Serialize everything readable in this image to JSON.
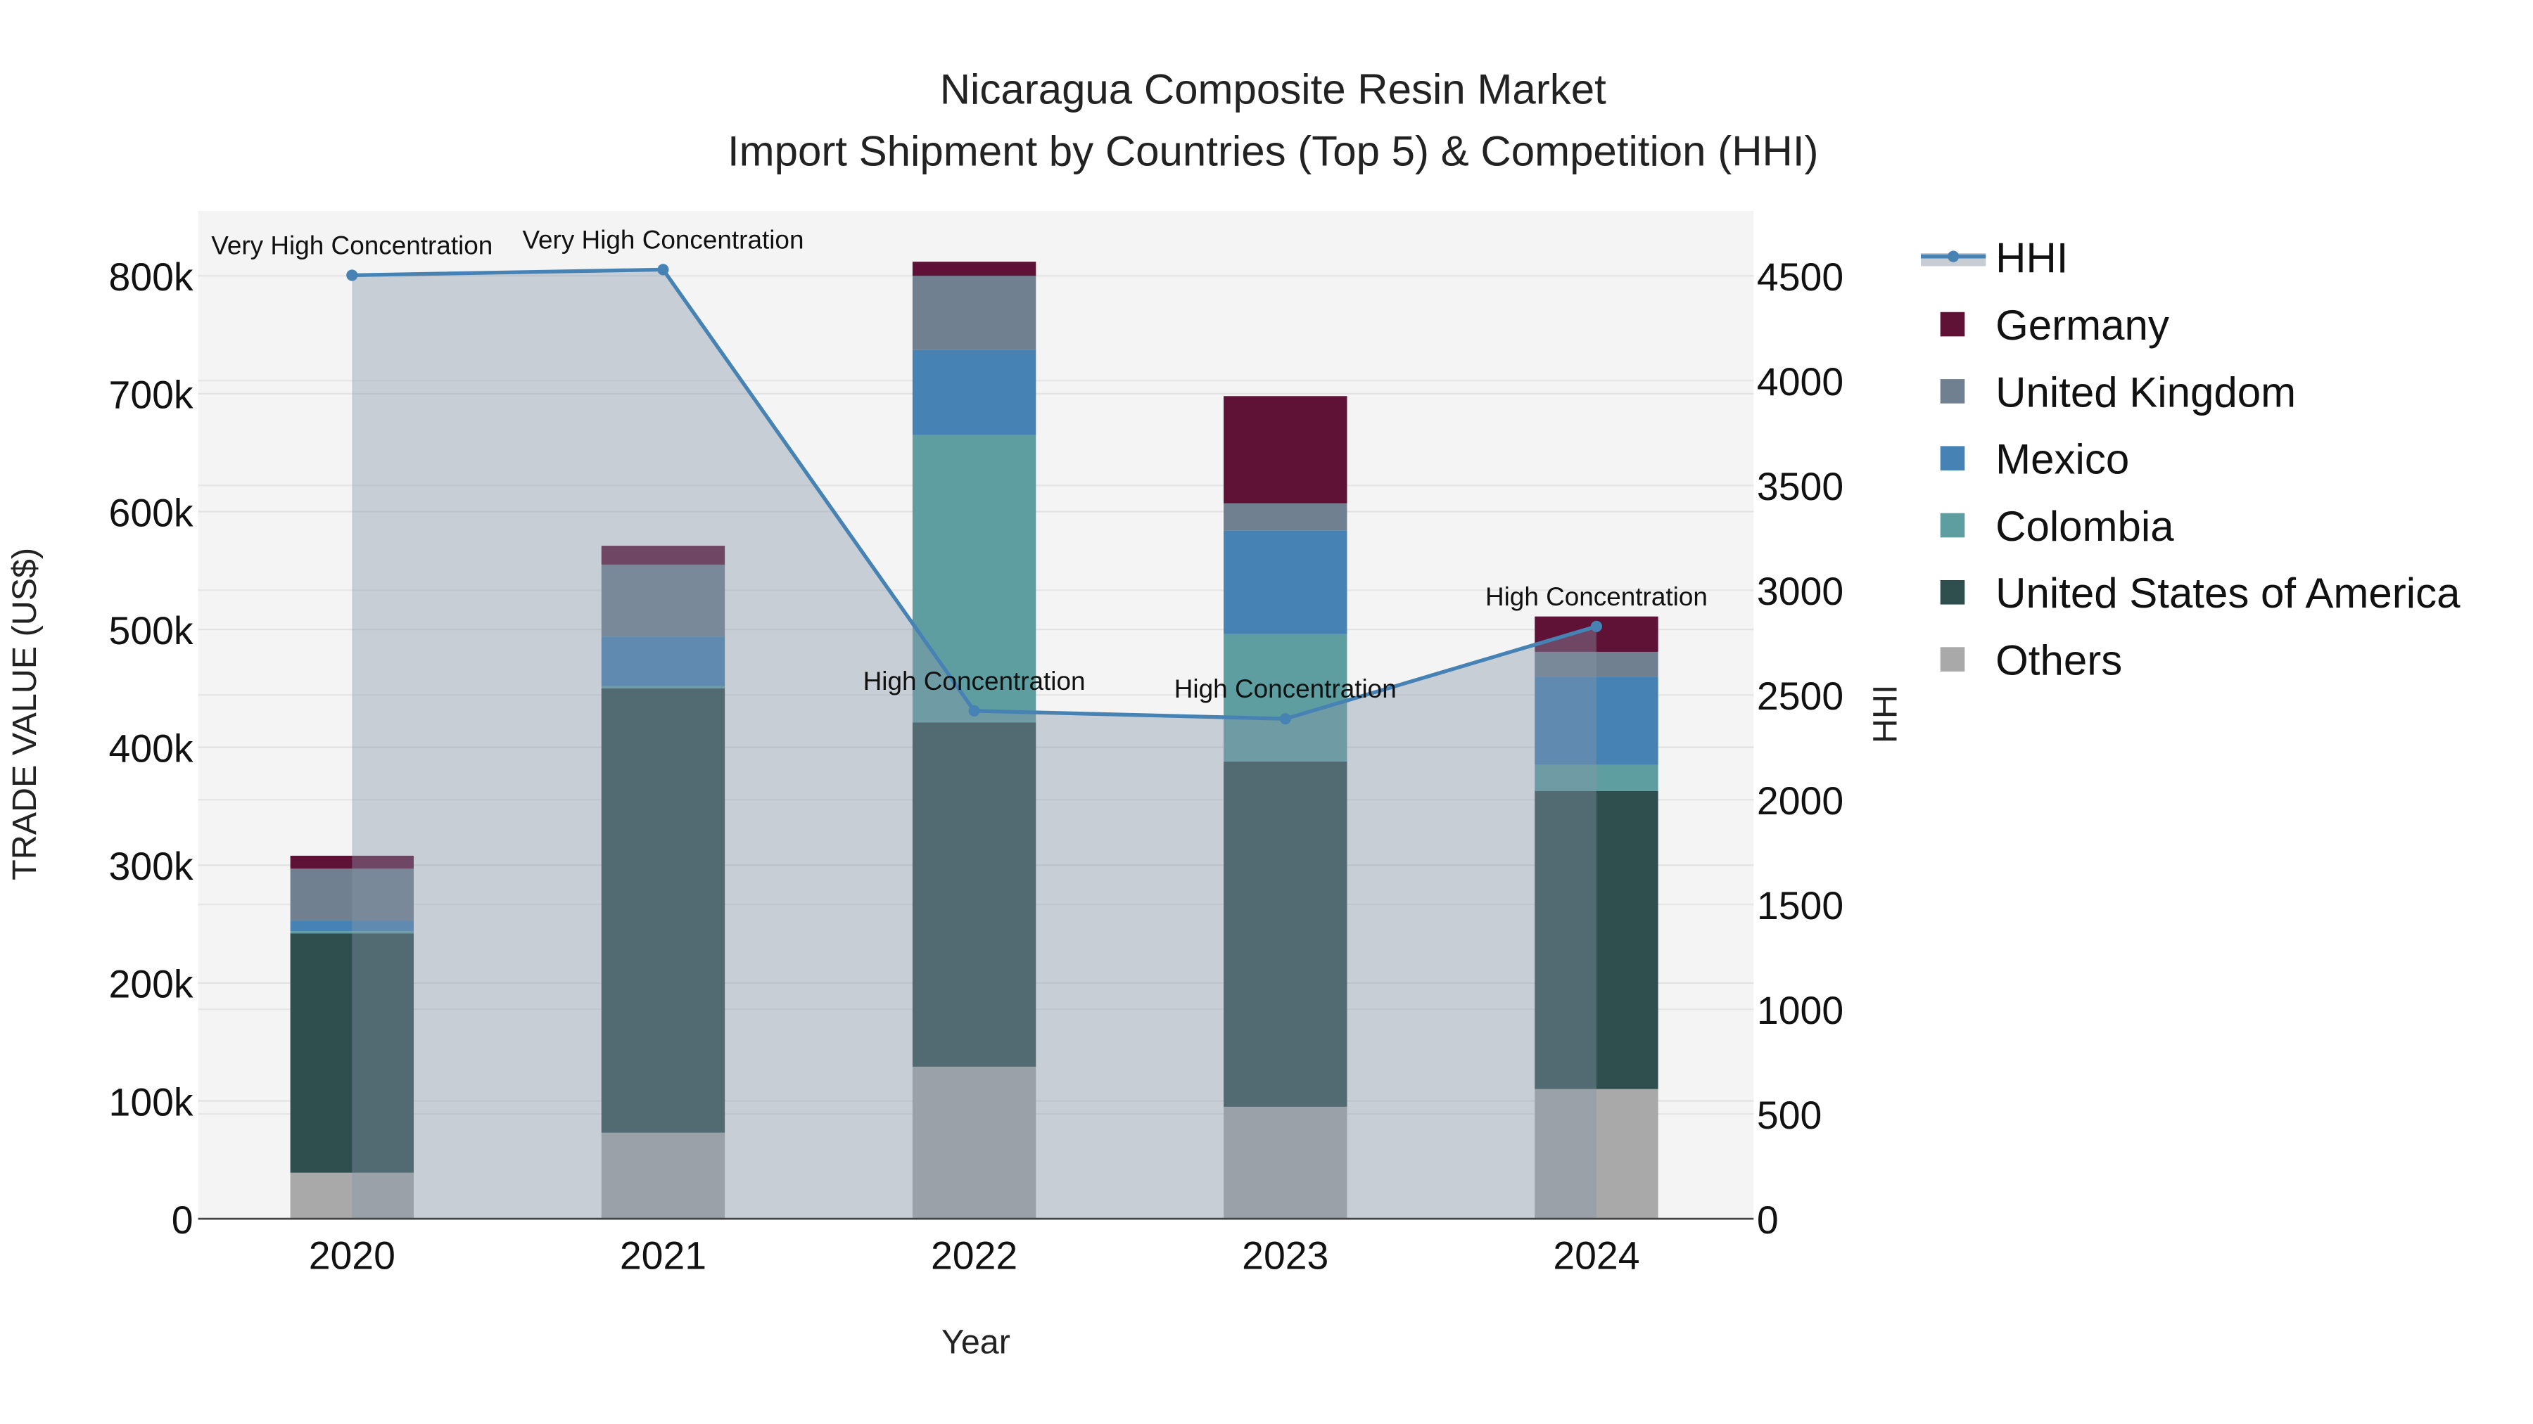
{
  "chart_data": {
    "type": "bar",
    "stacked": true,
    "title": "Nicaragua Composite Resin Market",
    "subtitle": "Import Shipment by Countries (Top 5) & Competition (HHI)",
    "xlabel": "Year",
    "ylabel": "TRADE VALUE (US$)",
    "y2label": "HHI",
    "categories": [
      "2020",
      "2021",
      "2022",
      "2023",
      "2024"
    ],
    "ylim": [
      0,
      860000
    ],
    "y2lim": [
      0,
      4820
    ],
    "yticks": [
      0,
      100000,
      200000,
      300000,
      400000,
      500000,
      600000,
      700000,
      800000
    ],
    "ytick_labels": [
      "0",
      "100k",
      "200k",
      "300k",
      "400k",
      "500k",
      "600k",
      "700k",
      "800k"
    ],
    "y2ticks": [
      0,
      500,
      1000,
      1500,
      2000,
      2500,
      3000,
      3500,
      4000,
      4500
    ],
    "y2tick_labels": [
      "0",
      "500",
      "1000",
      "1500",
      "2000",
      "2500",
      "3000",
      "3500",
      "4000",
      "4500"
    ],
    "grid": true,
    "legend_position": "right",
    "series": [
      {
        "name": "Others",
        "color": "#a9a9a9",
        "values": [
          39000,
          73000,
          129000,
          95000,
          110000
        ]
      },
      {
        "name": "United States of America",
        "color": "#2f4f4f",
        "values": [
          203000,
          377000,
          292000,
          293000,
          253000
        ]
      },
      {
        "name": "Colombia",
        "color": "#5f9ea0",
        "values": [
          2000,
          2000,
          244000,
          108000,
          22000
        ]
      },
      {
        "name": "Mexico",
        "color": "#4682b4",
        "values": [
          9000,
          42000,
          72000,
          88000,
          75000
        ]
      },
      {
        "name": "United Kingdom",
        "color": "#708090",
        "values": [
          44000,
          61000,
          63000,
          23000,
          21000
        ]
      },
      {
        "name": "Germany",
        "color": "#601236",
        "values": [
          11000,
          16000,
          12000,
          91000,
          30000
        ]
      }
    ],
    "line": {
      "name": "HHI",
      "color": "#4682b4",
      "values": [
        4503,
        4530,
        2424,
        2386,
        2827
      ],
      "annotations": [
        "Very High Concentration",
        "Very High Concentration",
        "High Concentration",
        "High Concentration",
        "High Concentration"
      ]
    },
    "legend_order": [
      "HHI",
      "Germany",
      "United Kingdom",
      "Mexico",
      "Colombia",
      "United States of America",
      "Others"
    ]
  }
}
